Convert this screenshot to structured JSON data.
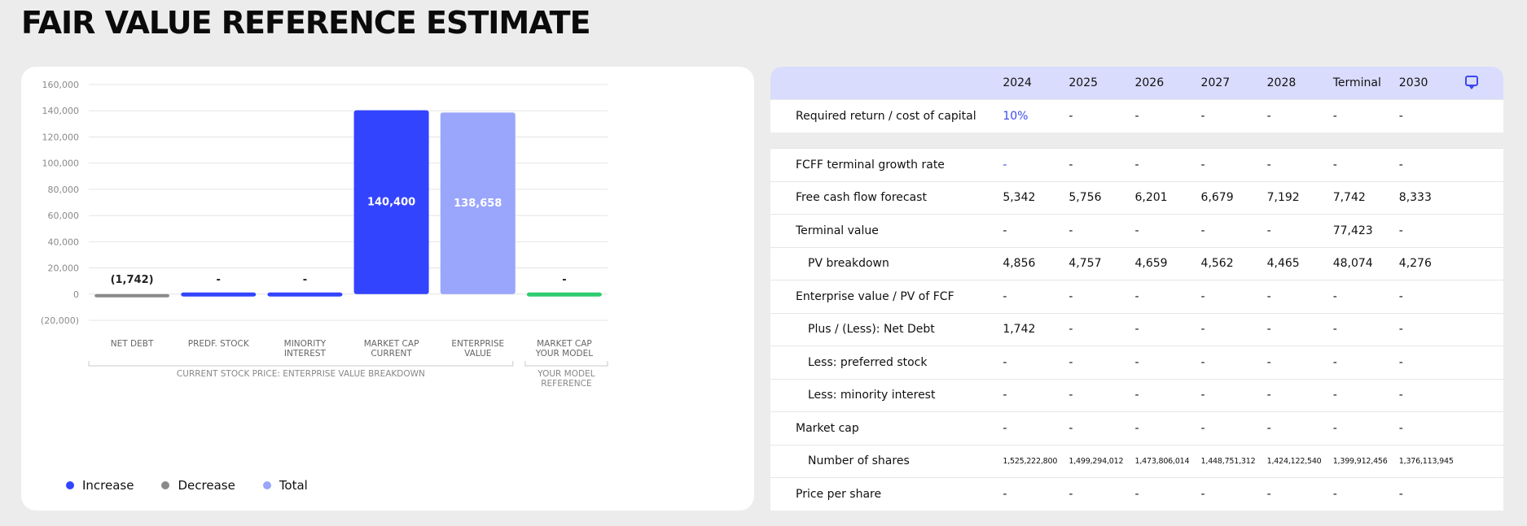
{
  "page": {
    "title": "FAIR VALUE REFERENCE ESTIMATE"
  },
  "chart_data": {
    "type": "bar",
    "categories": [
      [
        "NET DEBT"
      ],
      [
        "PREDF. STOCK"
      ],
      [
        "MINORITY",
        "INTEREST"
      ],
      [
        "MARKET CAP",
        "CURRENT"
      ],
      [
        "ENTERPRISE",
        "VALUE"
      ],
      [
        "MARKET CAP",
        "YOUR MODEL"
      ]
    ],
    "values": [
      -1742,
      0,
      0,
      140400,
      138658,
      0
    ],
    "data_labels": [
      "(1,742)",
      "-",
      "-",
      "140,400",
      "138,658",
      "-"
    ],
    "kinds": [
      "decrease",
      "increase",
      "increase",
      "increase",
      "total",
      "model"
    ],
    "yticks": [
      160000,
      140000,
      120000,
      100000,
      80000,
      60000,
      40000,
      20000,
      0,
      -20000
    ],
    "ytick_labels": [
      "160,000",
      "140,000",
      "120,000",
      "100,000",
      "80,000",
      "60,000",
      "40,000",
      "20,000",
      "0",
      "(20,000)"
    ],
    "ylim": [
      -20000,
      160000
    ],
    "group_labels": [
      [
        "CURRENT STOCK PRICE: ENTERPRISE VALUE BREAKDOWN"
      ],
      [
        "YOUR MODEL",
        "REFERENCE"
      ]
    ],
    "legend": [
      {
        "label": "Increase",
        "color": "#3344ff"
      },
      {
        "label": "Decrease",
        "color": "#8a8a8a"
      },
      {
        "label": "Total",
        "color": "#9aa6fb"
      }
    ],
    "colors": {
      "increase": "#3344ff",
      "decrease": "#8a8a8a",
      "total": "#9aa6fb",
      "model": "#2ecc71"
    },
    "grid": true
  },
  "table": {
    "columns": [
      "",
      "2024",
      "2025",
      "2026",
      "2027",
      "2028",
      "Terminal",
      "2030"
    ],
    "rows": [
      {
        "label": "Required return / cost of capital",
        "indent": false,
        "cells": [
          "10%",
          "-",
          "-",
          "-",
          "-",
          "-",
          "-"
        ],
        "accent_first": true
      },
      {
        "spacer": true
      },
      {
        "label": "FCFF terminal growth rate",
        "indent": false,
        "cells": [
          "-",
          "-",
          "-",
          "-",
          "-",
          "-",
          "-"
        ],
        "accent_first": true
      },
      {
        "label": "Free cash flow forecast",
        "indent": false,
        "cells": [
          "5,342",
          "5,756",
          "6,201",
          "6,679",
          "7,192",
          "7,742",
          "8,333"
        ]
      },
      {
        "label": "Terminal value",
        "indent": false,
        "cells": [
          "-",
          "-",
          "-",
          "-",
          "-",
          "77,423",
          "-"
        ]
      },
      {
        "label": "PV breakdown",
        "indent": true,
        "cells": [
          "4,856",
          "4,757",
          "4,659",
          "4,562",
          "4,465",
          "48,074",
          "4,276"
        ]
      },
      {
        "label": "Enterprise value / PV of FCF",
        "indent": false,
        "cells": [
          "-",
          "-",
          "-",
          "-",
          "-",
          "-",
          "-"
        ]
      },
      {
        "label": "Plus / (Less): Net Debt",
        "indent": true,
        "cells": [
          "1,742",
          "-",
          "-",
          "-",
          "-",
          "-",
          "-"
        ]
      },
      {
        "label": "Less: preferred stock",
        "indent": true,
        "cells": [
          "-",
          "-",
          "-",
          "-",
          "-",
          "-",
          "-"
        ]
      },
      {
        "label": "Less: minority interest",
        "indent": true,
        "cells": [
          "-",
          "-",
          "-",
          "-",
          "-",
          "-",
          "-"
        ]
      },
      {
        "label": "Market cap",
        "indent": false,
        "cells": [
          "-",
          "-",
          "-",
          "-",
          "-",
          "-",
          "-"
        ]
      },
      {
        "label": "Number of shares",
        "indent": true,
        "small": true,
        "cells": [
          "1,525,222,800",
          "1,499,294,012",
          "1,473,806,014",
          "1,448,751,312",
          "1,424,122,540",
          "1,399,912,456",
          "1,376,113,945"
        ]
      },
      {
        "label": "Price per share",
        "indent": false,
        "cells": [
          "-",
          "-",
          "-",
          "-",
          "-",
          "-",
          "-"
        ]
      }
    ],
    "header_icon": "comment-icon"
  }
}
